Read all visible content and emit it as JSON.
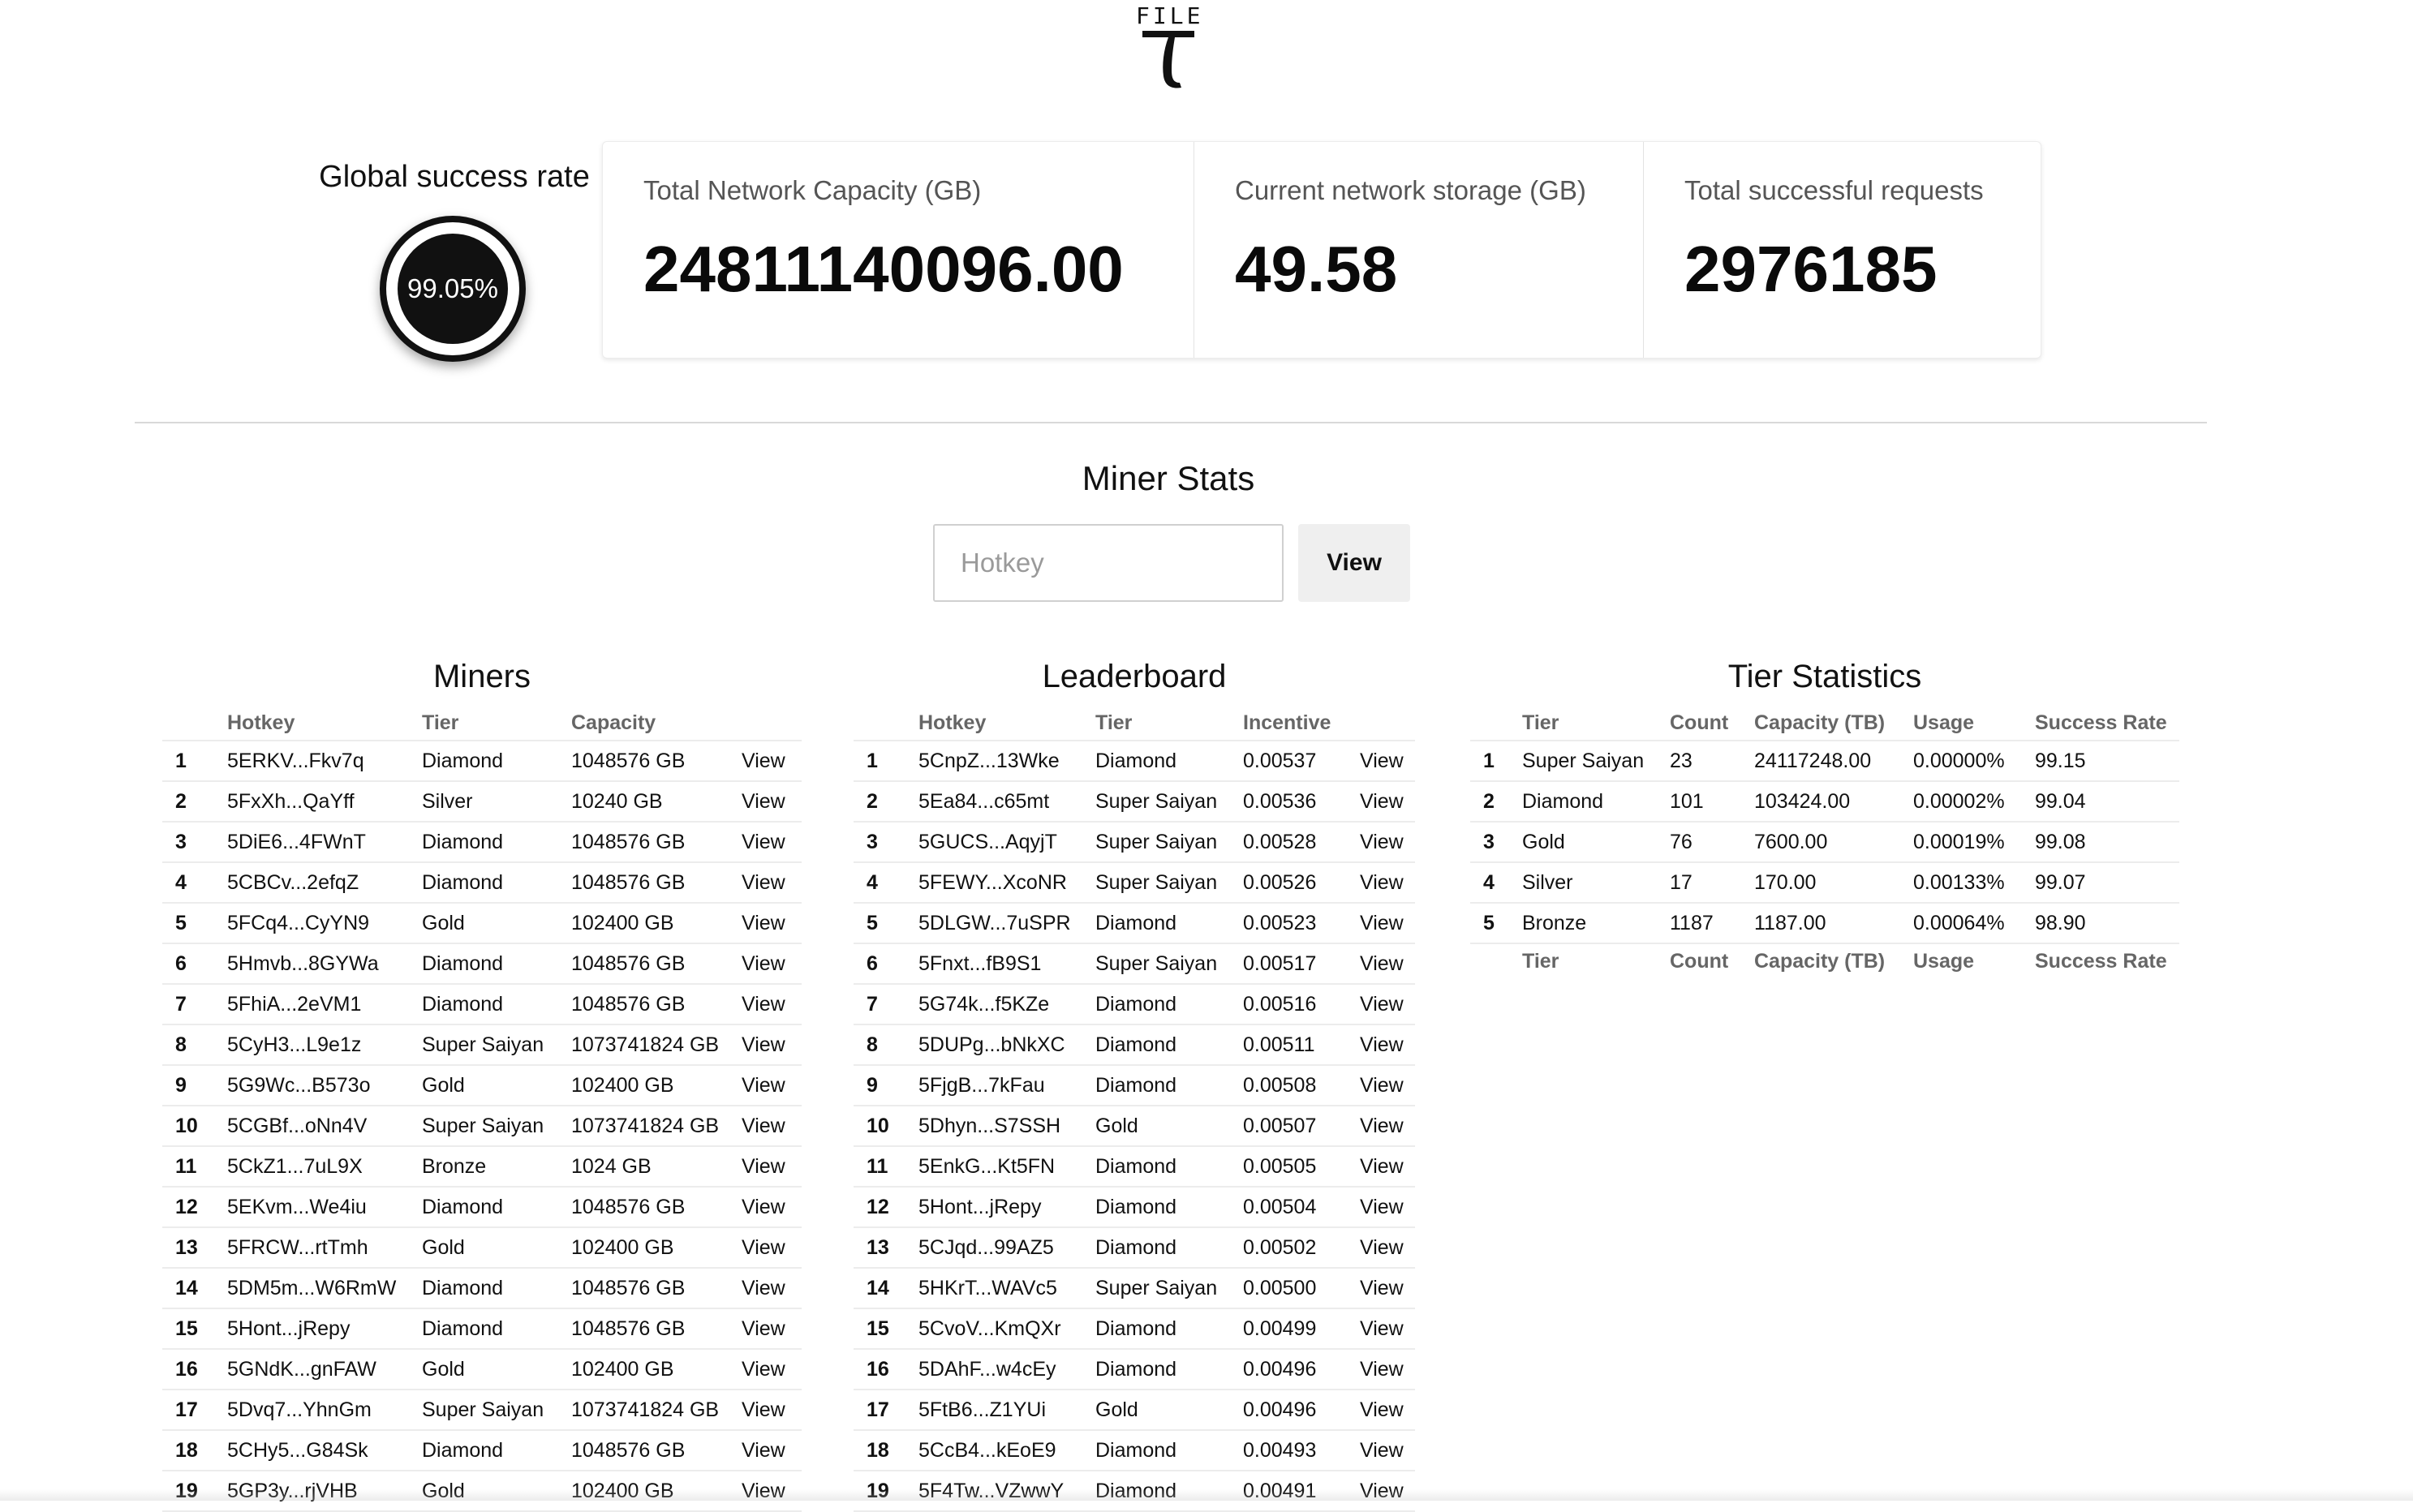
{
  "logo": {
    "word": "FILE"
  },
  "global_success": {
    "title": "Global success rate",
    "value": "99.05%"
  },
  "cards": [
    {
      "label": "Total Network Capacity (GB)",
      "value": "24811140096.00"
    },
    {
      "label": "Current network storage (GB)",
      "value": "49.58"
    },
    {
      "label": "Total successful requests",
      "value": "2976185"
    }
  ],
  "miner_stats": {
    "title": "Miner Stats",
    "placeholder": "Hotkey",
    "button": "View"
  },
  "miners": {
    "title": "Miners",
    "headers": [
      "",
      "Hotkey",
      "Tier",
      "Capacity",
      ""
    ],
    "rows": [
      [
        "1",
        "5ERKV...Fkv7q",
        "Diamond",
        "1048576 GB",
        "View"
      ],
      [
        "2",
        "5FxXh...QaYff",
        "Silver",
        "10240 GB",
        "View"
      ],
      [
        "3",
        "5DiE6...4FWnT",
        "Diamond",
        "1048576 GB",
        "View"
      ],
      [
        "4",
        "5CBCv...2efqZ",
        "Diamond",
        "1048576 GB",
        "View"
      ],
      [
        "5",
        "5FCq4...CyYN9",
        "Gold",
        "102400 GB",
        "View"
      ],
      [
        "6",
        "5Hmvb...8GYWa",
        "Diamond",
        "1048576 GB",
        "View"
      ],
      [
        "7",
        "5FhiA...2eVM1",
        "Diamond",
        "1048576 GB",
        "View"
      ],
      [
        "8",
        "5CyH3...L9e1z",
        "Super Saiyan",
        "1073741824 GB",
        "View"
      ],
      [
        "9",
        "5G9Wc...B573o",
        "Gold",
        "102400 GB",
        "View"
      ],
      [
        "10",
        "5CGBf...oNn4V",
        "Super Saiyan",
        "1073741824 GB",
        "View"
      ],
      [
        "11",
        "5CkZ1...7uL9X",
        "Bronze",
        "1024 GB",
        "View"
      ],
      [
        "12",
        "5EKvm...We4iu",
        "Diamond",
        "1048576 GB",
        "View"
      ],
      [
        "13",
        "5FRCW...rtTmh",
        "Gold",
        "102400 GB",
        "View"
      ],
      [
        "14",
        "5DM5m...W6RmW",
        "Diamond",
        "1048576 GB",
        "View"
      ],
      [
        "15",
        "5Hont...jRepy",
        "Diamond",
        "1048576 GB",
        "View"
      ],
      [
        "16",
        "5GNdK...gnFAW",
        "Gold",
        "102400 GB",
        "View"
      ],
      [
        "17",
        "5Dvq7...YhnGm",
        "Super Saiyan",
        "1073741824 GB",
        "View"
      ],
      [
        "18",
        "5CHy5...G84Sk",
        "Diamond",
        "1048576 GB",
        "View"
      ],
      [
        "19",
        "5GP3y...rjVHB",
        "Gold",
        "102400 GB",
        "View"
      ]
    ]
  },
  "leaderboard": {
    "title": "Leaderboard",
    "headers": [
      "",
      "Hotkey",
      "Tier",
      "Incentive",
      ""
    ],
    "rows": [
      [
        "1",
        "5CnpZ...13Wke",
        "Diamond",
        "0.00537",
        "View"
      ],
      [
        "2",
        "5Ea84...c65mt",
        "Super Saiyan",
        "0.00536",
        "View"
      ],
      [
        "3",
        "5GUCS...AqyjT",
        "Super Saiyan",
        "0.00528",
        "View"
      ],
      [
        "4",
        "5FEWY...XcoNR",
        "Super Saiyan",
        "0.00526",
        "View"
      ],
      [
        "5",
        "5DLGW...7uSPR",
        "Diamond",
        "0.00523",
        "View"
      ],
      [
        "6",
        "5Fnxt...fB9S1",
        "Super Saiyan",
        "0.00517",
        "View"
      ],
      [
        "7",
        "5G74k...f5KZe",
        "Diamond",
        "0.00516",
        "View"
      ],
      [
        "8",
        "5DUPg...bNkXC",
        "Diamond",
        "0.00511",
        "View"
      ],
      [
        "9",
        "5FjgB...7kFau",
        "Diamond",
        "0.00508",
        "View"
      ],
      [
        "10",
        "5Dhyn...S7SSH",
        "Gold",
        "0.00507",
        "View"
      ],
      [
        "11",
        "5EnkG...Kt5FN",
        "Diamond",
        "0.00505",
        "View"
      ],
      [
        "12",
        "5Hont...jRepy",
        "Diamond",
        "0.00504",
        "View"
      ],
      [
        "13",
        "5CJqd...99AZ5",
        "Diamond",
        "0.00502",
        "View"
      ],
      [
        "14",
        "5HKrT...WAVc5",
        "Super Saiyan",
        "0.00500",
        "View"
      ],
      [
        "15",
        "5CvoV...KmQXr",
        "Diamond",
        "0.00499",
        "View"
      ],
      [
        "16",
        "5DAhF...w4cEy",
        "Diamond",
        "0.00496",
        "View"
      ],
      [
        "17",
        "5FtB6...Z1YUi",
        "Gold",
        "0.00496",
        "View"
      ],
      [
        "18",
        "5CcB4...kEoE9",
        "Diamond",
        "0.00493",
        "View"
      ],
      [
        "19",
        "5F4Tw...VZwwY",
        "Diamond",
        "0.00491",
        "View"
      ]
    ]
  },
  "tier_stats": {
    "title": "Tier Statistics",
    "headers": [
      "",
      "Tier",
      "Count",
      "Capacity (TB)",
      "Usage",
      "Success Rate"
    ],
    "rows": [
      [
        "1",
        "Super Saiyan",
        "23",
        "24117248.00",
        "0.00000%",
        "99.15"
      ],
      [
        "2",
        "Diamond",
        "101",
        "103424.00",
        "0.00002%",
        "99.04"
      ],
      [
        "3",
        "Gold",
        "76",
        "7600.00",
        "0.00019%",
        "99.08"
      ],
      [
        "4",
        "Silver",
        "17",
        "170.00",
        "0.00133%",
        "99.07"
      ],
      [
        "5",
        "Bronze",
        "1187",
        "1187.00",
        "0.00064%",
        "98.90"
      ]
    ],
    "footer": [
      "",
      "Tier",
      "Count",
      "Capacity (TB)",
      "Usage",
      "Success Rate"
    ]
  }
}
